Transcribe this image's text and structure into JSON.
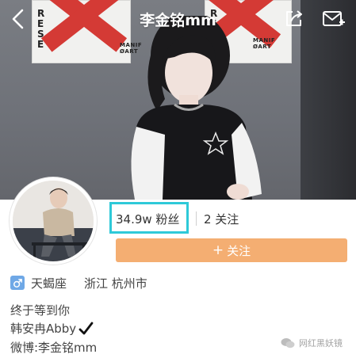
{
  "header": {
    "title": "李金铭mm"
  },
  "cover": {
    "poster_left_text": "RESE",
    "poster_left_small": "MANIF ØART",
    "poster_right_text": "RESE",
    "poster_right_small": "MANIF ØART"
  },
  "stats": {
    "fans": "34.9w 粉丝",
    "following": "2 关注"
  },
  "follow_button": {
    "plus": "+",
    "label": "关注"
  },
  "profile": {
    "zodiac": "天蝎座",
    "location": "浙江 杭州市",
    "bio_line1": "终于等到你",
    "bio_line2": "韩安冉Abby",
    "bio_line3": "微博:李金铭mm"
  },
  "watermark": {
    "text": "网红黑妖镜"
  },
  "colors": {
    "follow_button": "#f4ae72",
    "highlight_box": "#2ec9d8",
    "gender_badge": "#6fa8e6"
  },
  "icons": {
    "back": "chevron-left-icon",
    "share": "share-icon",
    "mail": "mail-icon",
    "gender": "male-icon",
    "verified": "checkmark-icon"
  }
}
